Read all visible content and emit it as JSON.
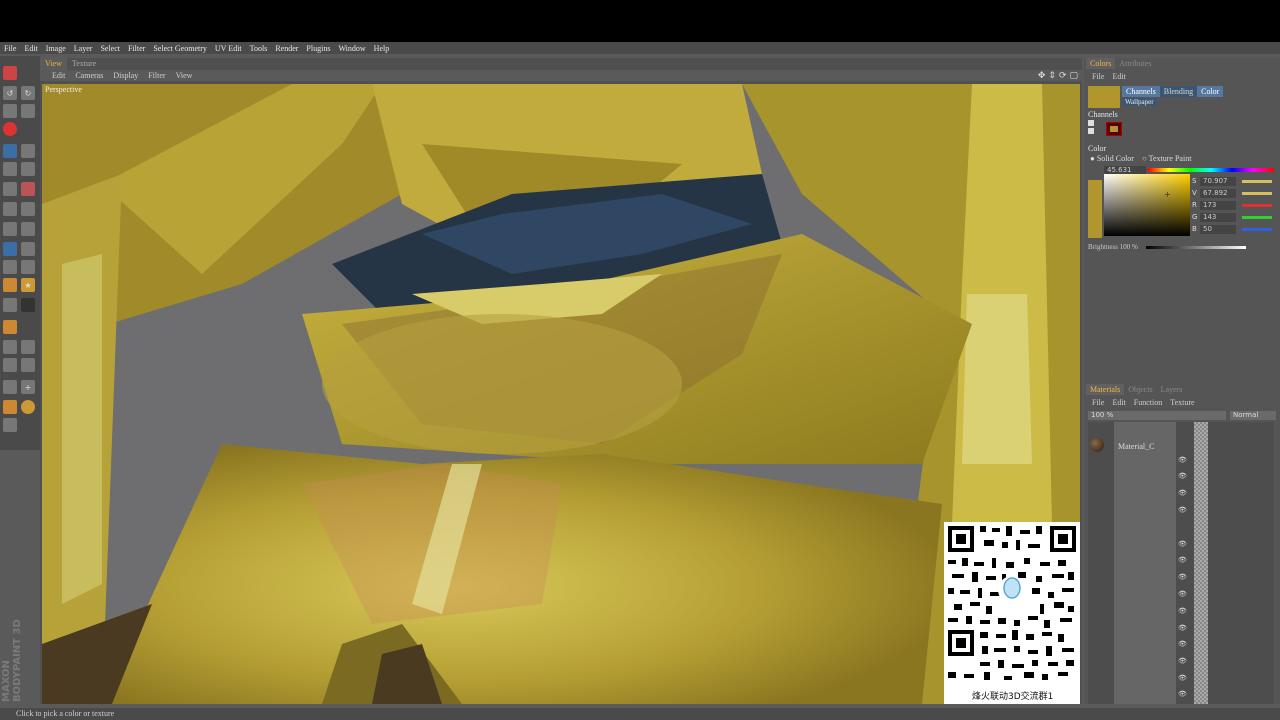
{
  "menubar": {
    "items": [
      "File",
      "Edit",
      "Image",
      "Layer",
      "Select",
      "Filter",
      "Select Geometry",
      "UV Edit",
      "Tools",
      "Render",
      "Plugins",
      "Window",
      "Help"
    ]
  },
  "viewport_tabs": [
    "View",
    "Texture"
  ],
  "viewport_menu": [
    "Edit",
    "Cameras",
    "Display",
    "Filter",
    "View"
  ],
  "viewport_label": "Perspective",
  "branding": {
    "line1": "MAXON",
    "line2": "BODYPAINT 3D"
  },
  "overlay": {
    "group_caption": "烽火联动3D交流群1"
  },
  "status": "Click to pick a color or texture",
  "colors_panel": {
    "tabs": [
      "Colors",
      "Attributes"
    ],
    "menu": [
      "File",
      "Edit"
    ],
    "mode_tabs": [
      "Channels",
      "Blending",
      "Color"
    ],
    "wallpaper": "Wallpaper",
    "channels_header": "Channels",
    "color_header": "Color",
    "modes": [
      "Solid Color",
      "Texture Paint"
    ],
    "hue": "45.631",
    "sliders": [
      {
        "label": "S",
        "value": "70.907",
        "color": "#d4c060"
      },
      {
        "label": "V",
        "value": "67.892",
        "color": "#d4c060"
      },
      {
        "label": "R",
        "value": "173",
        "color": "#e03030"
      },
      {
        "label": "G",
        "value": "143",
        "color": "#30d030"
      },
      {
        "label": "B",
        "value": "50",
        "color": "#3060e0"
      }
    ],
    "brightness_label": "Brightness",
    "brightness_value": "100 %",
    "swatch_color": "#b0962c"
  },
  "materials_panel": {
    "tabs": [
      "Materials",
      "Objects",
      "Layers"
    ],
    "menu": [
      "File",
      "Edit",
      "Function",
      "Texture"
    ],
    "zoom": "100 %",
    "blend_mode": "Normal",
    "material_name": "Material_C"
  }
}
